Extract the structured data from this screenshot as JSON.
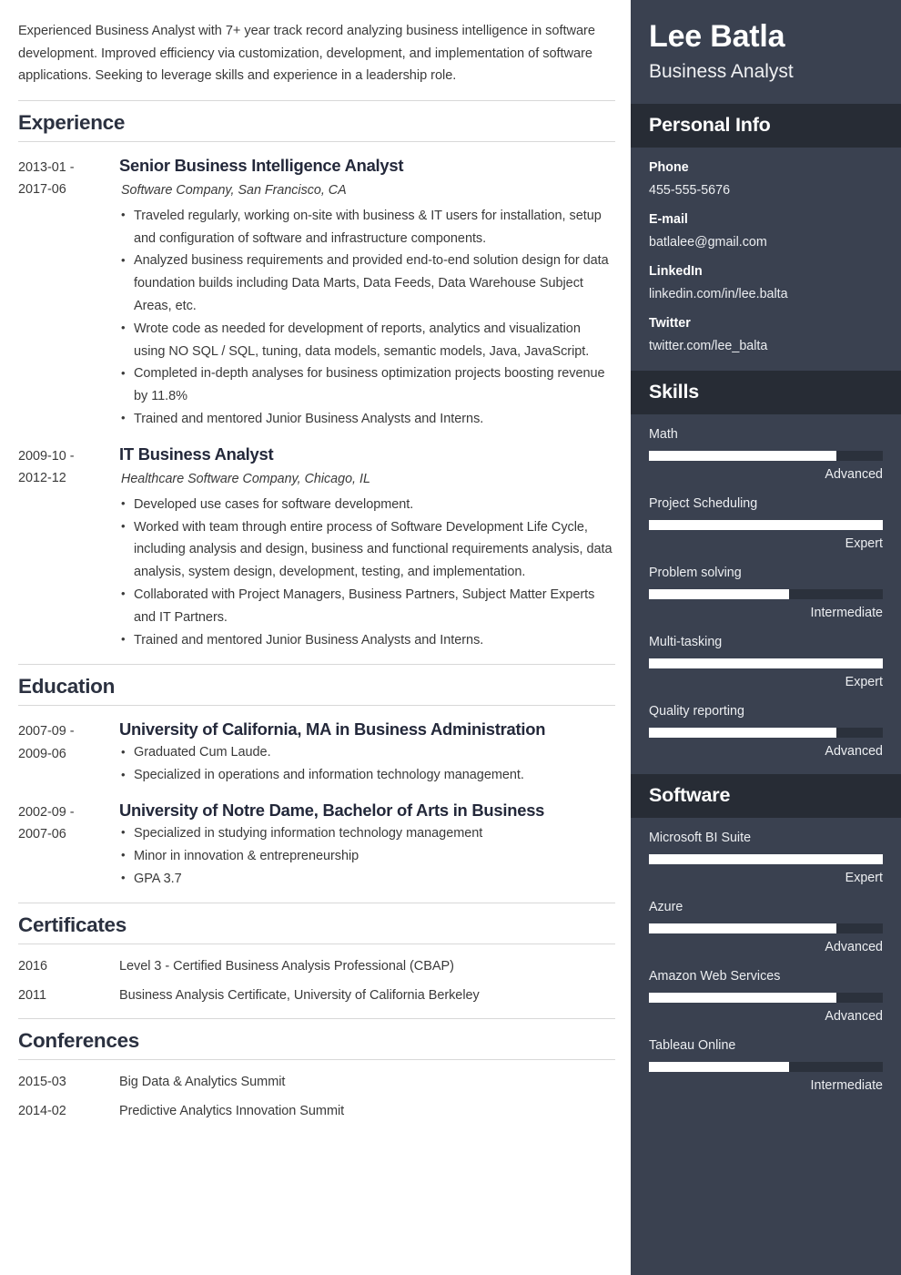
{
  "summary": "Experienced Business Analyst with 7+ year track record analyzing business intelligence in software development. Improved efficiency via customization, development, and implementation of software applications. Seeking to leverage skills and experience in a leadership role.",
  "sections": {
    "experience": {
      "title": "Experience",
      "entries": [
        {
          "dates": "2013-01 - 2017-06",
          "title": "Senior Business Intelligence Analyst",
          "org": "Software Company, San Francisco, CA",
          "bullets": [
            "Traveled regularly, working on-site with business & IT users for installation, setup and configuration of software and infrastructure components.",
            "Analyzed business requirements and provided end-to-end solution design for data foundation builds including Data Marts, Data Feeds, Data Warehouse Subject Areas, etc.",
            "Wrote code as needed for development of reports, analytics and visualization using NO SQL / SQL, tuning, data models, semantic models, Java, JavaScript.",
            "Completed in-depth analyses for business optimization projects boosting revenue by 11.8%",
            "Trained and mentored Junior Business Analysts and Interns."
          ]
        },
        {
          "dates": "2009-10 - 2012-12",
          "title": "IT Business Analyst",
          "org": "Healthcare Software Company, Chicago, IL",
          "bullets": [
            "Developed use cases for software development.",
            "Worked with team through entire process of Software Development Life Cycle, including analysis and design, business and functional requirements analysis, data analysis, system design, development, testing, and implementation.",
            "Collaborated with Project Managers, Business Partners, Subject Matter Experts and IT Partners.",
            "Trained and mentored Junior Business Analysts and Interns."
          ]
        }
      ]
    },
    "education": {
      "title": "Education",
      "entries": [
        {
          "dates": "2007-09 - 2009-06",
          "title": "University of California, MA in Business Administration",
          "bullets": [
            "Graduated Cum Laude.",
            "Specialized in operations and information technology management."
          ]
        },
        {
          "dates": "2002-09 - 2007-06",
          "title": "University of Notre Dame, Bachelor of Arts in Business",
          "bullets": [
            "Specialized in studying information technology management",
            "Minor in innovation & entrepreneurship",
            "GPA 3.7"
          ]
        }
      ]
    },
    "certificates": {
      "title": "Certificates",
      "rows": [
        {
          "year": "2016",
          "label": "Level 3 - Certified Business Analysis Professional (CBAP)"
        },
        {
          "year": "2011",
          "label": "Business Analysis Certificate, University of California Berkeley"
        }
      ]
    },
    "conferences": {
      "title": "Conferences",
      "rows": [
        {
          "year": "2015-03",
          "label": "Big Data & Analytics Summit"
        },
        {
          "year": "2014-02",
          "label": "Predictive Analytics Innovation Summit"
        }
      ]
    }
  },
  "sidebar": {
    "name": "Lee Batla",
    "role": "Business Analyst",
    "personal_info": {
      "title": "Personal Info",
      "items": [
        {
          "key": "Phone",
          "value": "455-555-5676"
        },
        {
          "key": "E-mail",
          "value": "batlalee@gmail.com"
        },
        {
          "key": "LinkedIn",
          "value": "linkedin.com/in/lee.balta"
        },
        {
          "key": "Twitter",
          "value": "twitter.com/lee_balta"
        }
      ]
    },
    "skills": {
      "title": "Skills",
      "items": [
        {
          "name": "Math",
          "level": "Advanced",
          "percent": 80
        },
        {
          "name": "Project Scheduling",
          "level": "Expert",
          "percent": 100
        },
        {
          "name": "Problem solving",
          "level": "Intermediate",
          "percent": 60
        },
        {
          "name": "Multi-tasking",
          "level": "Expert",
          "percent": 100
        },
        {
          "name": "Quality reporting",
          "level": "Advanced",
          "percent": 80
        }
      ]
    },
    "software": {
      "title": "Software",
      "items": [
        {
          "name": "Microsoft BI Suite",
          "level": "Expert",
          "percent": 100
        },
        {
          "name": "Azure",
          "level": "Advanced",
          "percent": 80
        },
        {
          "name": "Amazon Web Services",
          "level": "Advanced",
          "percent": 80
        },
        {
          "name": "Tableau Online",
          "level": "Intermediate",
          "percent": 60
        }
      ]
    }
  },
  "colors": {
    "sidebar_bg": "#3a4150",
    "sidebar_header_bg": "#272c35",
    "bar_track": "#2b313c",
    "bar_fill": "#ffffff",
    "heading": "#2b3140",
    "rule": "#d8d8d8"
  }
}
